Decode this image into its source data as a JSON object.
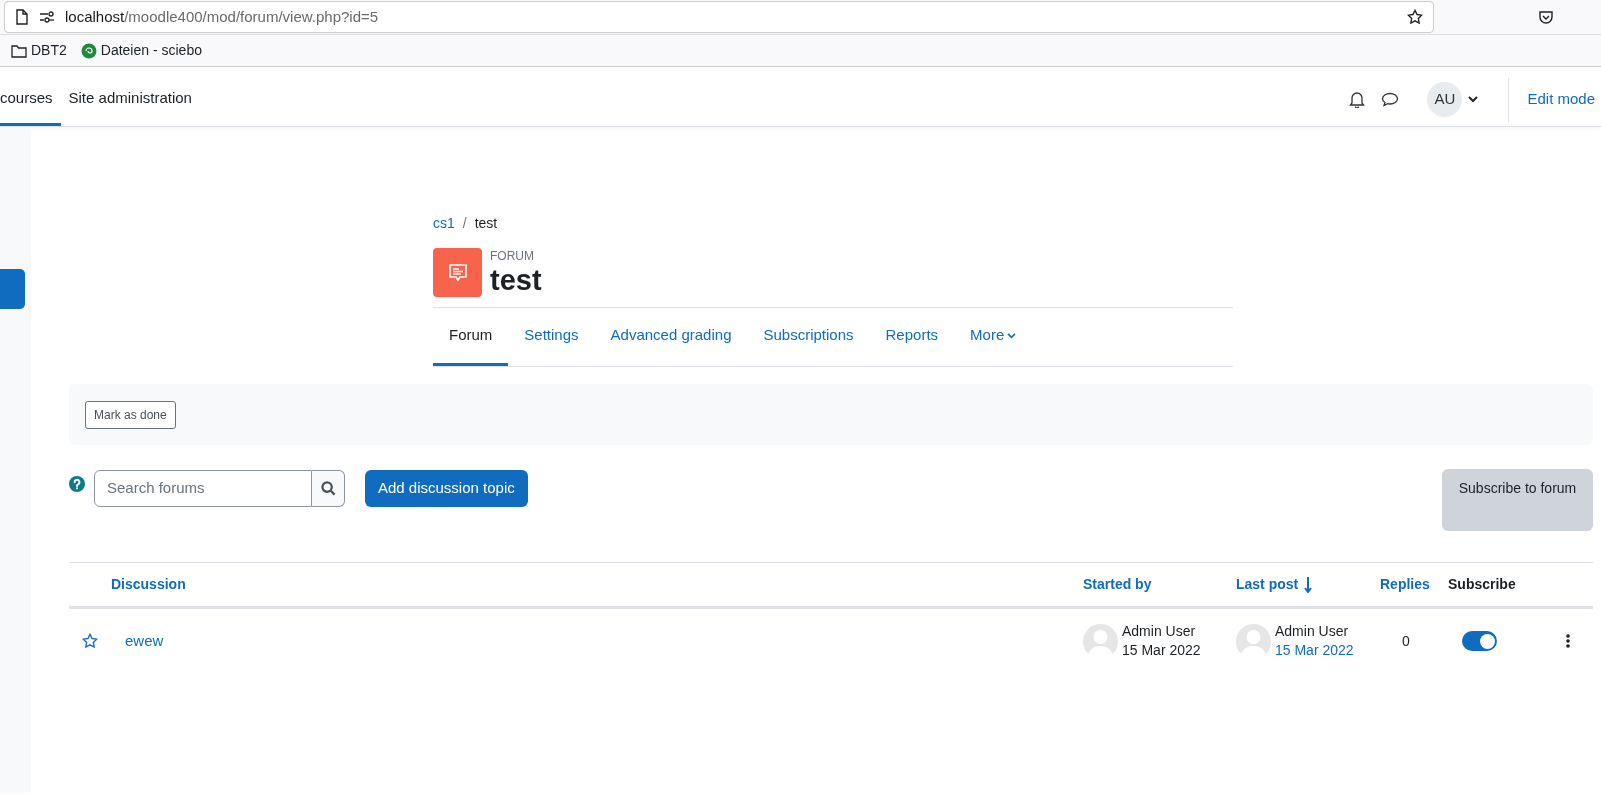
{
  "browser": {
    "url_host": "localhost",
    "url_path": "/moodle400/mod/forum/view.php?id=5",
    "bookmarks": [
      {
        "kind": "folder",
        "label": "DBT2"
      },
      {
        "kind": "site",
        "label": "Dateien - sciebo"
      }
    ]
  },
  "navbar": {
    "items": [
      {
        "label": "courses",
        "selected": true
      },
      {
        "label": "Site administration",
        "selected": false
      }
    ],
    "avatar": "AU",
    "edit_mode": "Edit mode"
  },
  "breadcrumb_separator": "/",
  "breadcrumb": [
    {
      "label": "cs1",
      "link": true
    },
    {
      "label": "test",
      "link": false
    }
  ],
  "activity": {
    "type": "FORUM",
    "title": "test"
  },
  "tabs": [
    {
      "label": "Forum",
      "selected": true
    },
    {
      "label": "Settings",
      "selected": false
    },
    {
      "label": "Advanced grading",
      "selected": false
    },
    {
      "label": "Subscriptions",
      "selected": false
    },
    {
      "label": "Reports",
      "selected": false
    },
    {
      "label": "More",
      "selected": false
    }
  ],
  "completion": {
    "button": "Mark as done"
  },
  "search": {
    "placeholder": "Search forums"
  },
  "add_button": "Add discussion topic",
  "subscribe_button": "Subscribe to forum",
  "table": {
    "columns": [
      {
        "label": "Discussion",
        "sortable": true
      },
      {
        "label": "Started by",
        "sortable": true
      },
      {
        "label": "Last post",
        "sortable": true
      },
      {
        "label": "Replies",
        "sortable": true
      },
      {
        "label": "Subscribe",
        "sortable": false
      }
    ],
    "rows": [
      {
        "starred": false,
        "discussion": "ewew",
        "started_by": "Admin User",
        "started_date": "15 Mar 2022",
        "last_by": "Admin User",
        "last_date": "15 Mar 2022",
        "replies": "0",
        "subscribed": true
      }
    ]
  }
}
